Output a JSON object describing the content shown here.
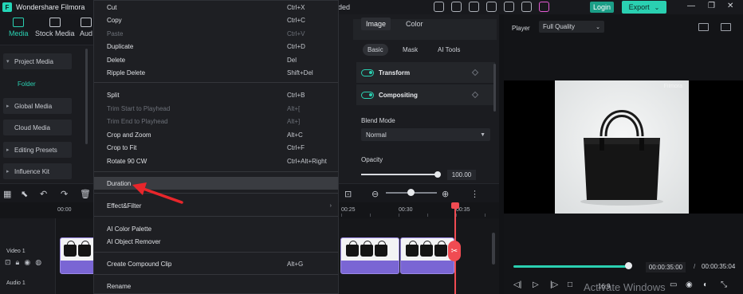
{
  "app": {
    "title": "Wondershare Filmora",
    "title_fragment": "ded"
  },
  "header": {
    "login_label": "Login",
    "export_label": "Export",
    "export_chevron": "⌄"
  },
  "left_tabs": [
    {
      "label": "Media",
      "active": true
    },
    {
      "label": "Stock Media",
      "active": false
    },
    {
      "label": "Aud",
      "active": false
    }
  ],
  "sidebar": {
    "items": [
      {
        "label": "Project Media",
        "expanded": true
      },
      {
        "label": "Global Media",
        "expanded": false
      },
      {
        "label": "Cloud Media",
        "expanded": false
      },
      {
        "label": "Editing Presets",
        "expanded": false
      },
      {
        "label": "Influence Kit",
        "expanded": false
      }
    ],
    "folder_label": "Folder"
  },
  "context_menu": {
    "items": [
      {
        "label": "Cut",
        "shortcut": "Ctrl+X",
        "disabled": false
      },
      {
        "label": "Copy",
        "shortcut": "Ctrl+C",
        "disabled": false
      },
      {
        "label": "Paste",
        "shortcut": "Ctrl+V",
        "disabled": true
      },
      {
        "label": "Duplicate",
        "shortcut": "Ctrl+D",
        "disabled": false
      },
      {
        "label": "Delete",
        "shortcut": "Del",
        "disabled": false
      },
      {
        "label": "Ripple Delete",
        "shortcut": "Shift+Del",
        "disabled": false
      },
      {
        "label": "Split",
        "shortcut": "Ctrl+B",
        "disabled": false
      },
      {
        "label": "Trim Start to Playhead",
        "shortcut": "Alt+[",
        "disabled": true
      },
      {
        "label": "Trim End to Playhead",
        "shortcut": "Alt+]",
        "disabled": true
      },
      {
        "label": "Crop and Zoom",
        "shortcut": "Alt+C",
        "disabled": false
      },
      {
        "label": "Crop to Fit",
        "shortcut": "Ctrl+F",
        "disabled": false
      },
      {
        "label": "Rotate 90 CW",
        "shortcut": "Ctrl+Alt+Right",
        "disabled": false
      },
      {
        "label": "Duration",
        "shortcut": "",
        "disabled": false,
        "highlighted": true
      },
      {
        "label": "Effect&Filter",
        "shortcut": "",
        "disabled": false,
        "submenu": true
      },
      {
        "label": "AI Color Palette",
        "shortcut": "",
        "disabled": false
      },
      {
        "label": "AI Object Remover",
        "shortcut": "",
        "disabled": false
      },
      {
        "label": "Create Compound Clip",
        "shortcut": "Alt+G",
        "disabled": false
      },
      {
        "label": "Rename",
        "shortcut": "",
        "disabled": false
      }
    ],
    "submenu_glyph": "›"
  },
  "properties": {
    "tabs": [
      "Image",
      "Color"
    ],
    "active_tab": "Image",
    "subtabs": [
      "Basic",
      "Mask",
      "AI Tools"
    ],
    "active_subtab": "Basic",
    "sections": [
      {
        "label": "Transform",
        "enabled": true
      },
      {
        "label": "Compositing",
        "enabled": true
      }
    ],
    "blend_mode_label": "Blend Mode",
    "blend_mode_value": "Normal",
    "opacity_label": "Opacity",
    "opacity_value": "100.00",
    "opacity_level": 1.0
  },
  "player": {
    "label": "Player",
    "quality": "Full Quality",
    "preview_watermark": "Filmora",
    "current_time": "00:00:35:00",
    "time_separator": "/",
    "total_time": "00:00:35:04",
    "progress": 0.99,
    "ratio_label": "16:9",
    "activate_overlay": "Activate Windows"
  },
  "timeline": {
    "ruler_labels": [
      "00:00",
      "00:25",
      "00:30",
      "00:35"
    ],
    "tracks": [
      {
        "label": "Video 1"
      },
      {
        "label": "Audio 1"
      }
    ]
  },
  "colors": {
    "accent": "#2ad0b1",
    "playhead": "#f04b52",
    "clip": "#7a66d4",
    "annotation_arrow": "#e8262b"
  }
}
